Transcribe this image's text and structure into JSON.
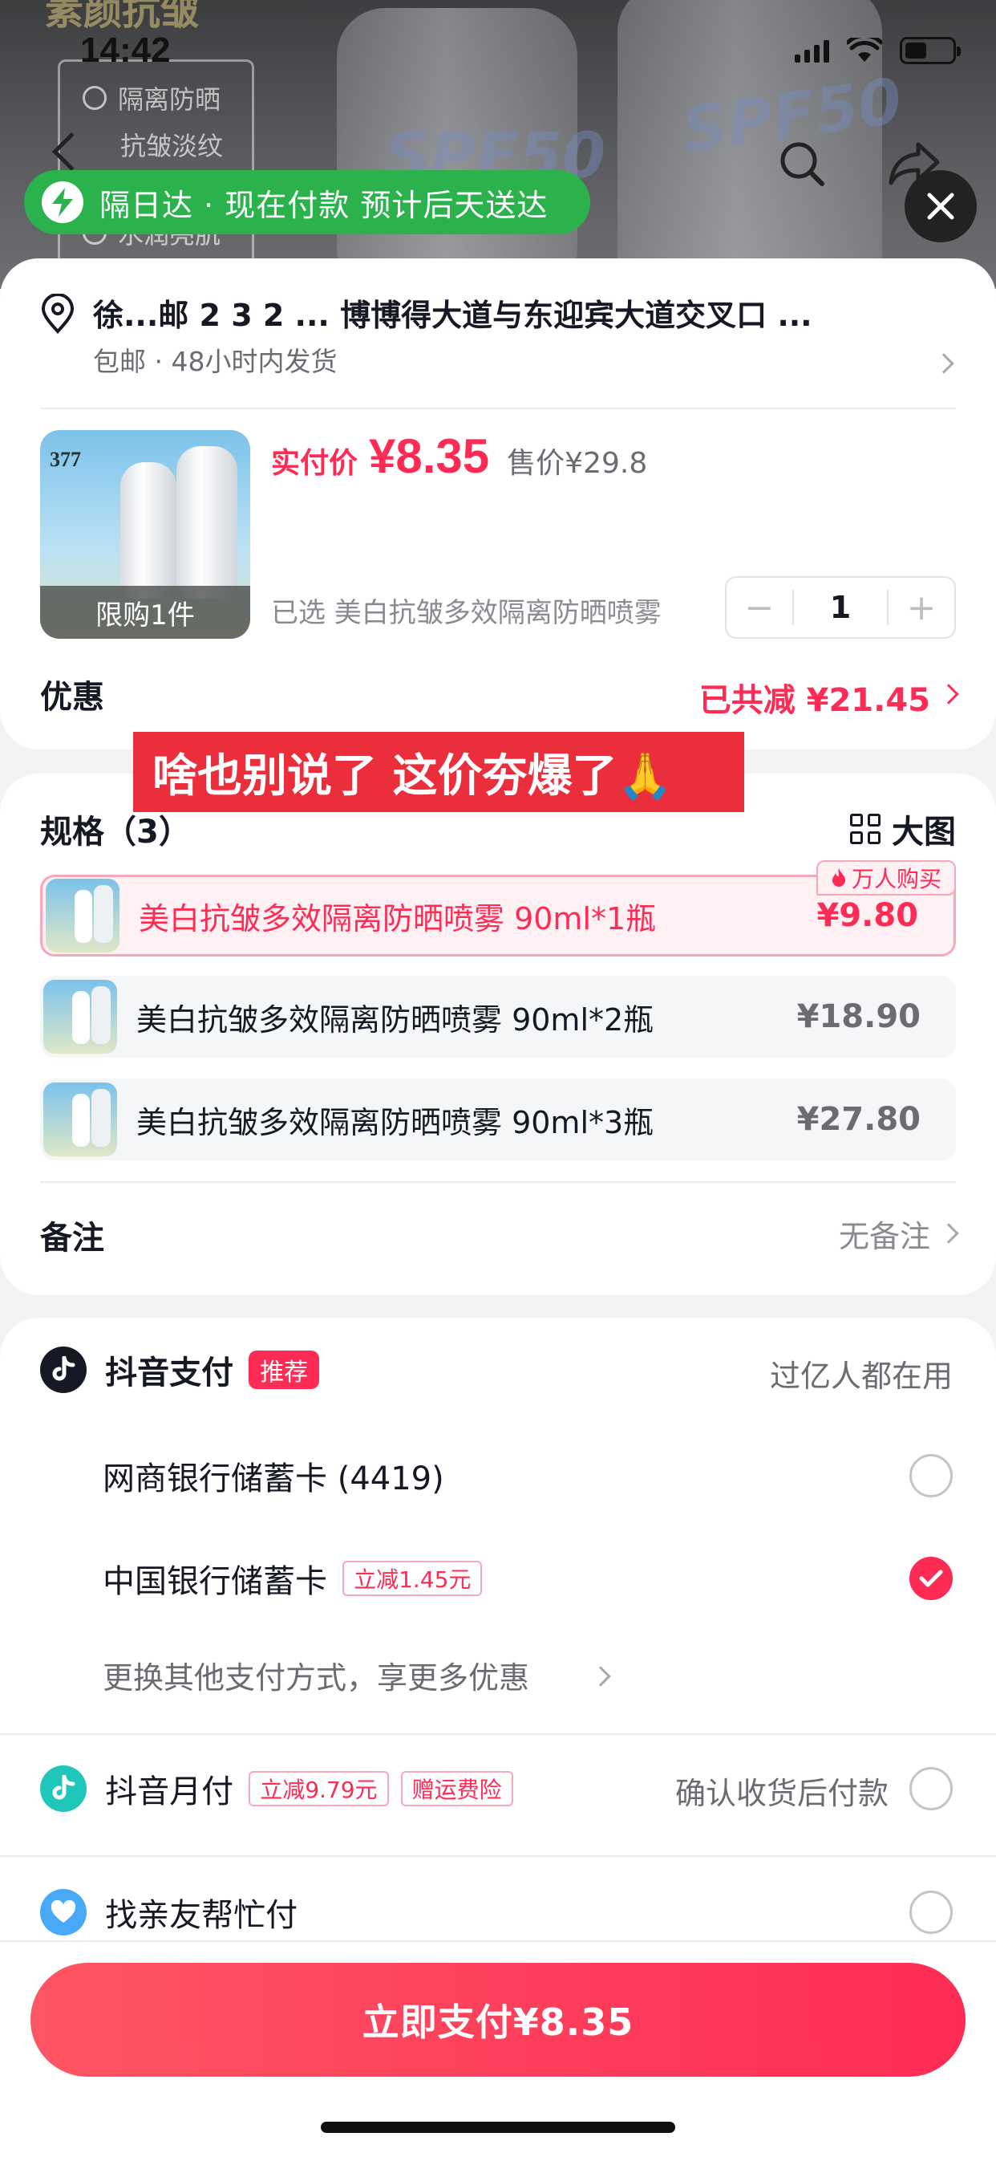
{
  "status_bar": {
    "time": "14:42"
  },
  "background": {
    "promo_text": "素颜抗皱",
    "card_lines": [
      "隔离防晒",
      "抗皱淡纹",
      "水润亮肌"
    ],
    "spf_text": "SPF50"
  },
  "delivery_pill": {
    "text": "隔日达 · 现在付款 预计后天送达"
  },
  "address": {
    "text": "徐...邮 2 3 2 ... 博博得大道与东迎宾大道交叉口 ...",
    "sub": "包邮 · 48小时内发货"
  },
  "product": {
    "image_caption": "限购1件",
    "image_brand": "377",
    "price_label": "实付价",
    "price": "¥8.35",
    "original_price": "售价¥29.8",
    "chosen": "已选  美白抗皱多效隔离防晒喷雾",
    "quantity": "1"
  },
  "discount": {
    "label": "优惠",
    "value": "已共减 ¥21.45"
  },
  "overlay_banner": {
    "text": "啥也别说了 这价夯爆了🙏"
  },
  "specs": {
    "title": "规格（3）",
    "big_view": "大图",
    "hot_badge": "万人购买",
    "items": [
      {
        "name": "美白抗皱多效隔离防晒喷雾 90ml*1瓶",
        "price": "¥9.80",
        "selected": true
      },
      {
        "name": "美白抗皱多效隔离防晒喷雾 90ml*2瓶",
        "price": "¥18.90",
        "selected": false
      },
      {
        "name": "美白抗皱多效隔离防晒喷雾 90ml*3瓶",
        "price": "¥27.80",
        "selected": false
      }
    ]
  },
  "note": {
    "label": "备注",
    "value": "无备注"
  },
  "payment": {
    "douyin_pay": {
      "label": "抖音支付",
      "tag": "推荐",
      "desc": "过亿人都在用"
    },
    "card_1": {
      "label": "网商银行储蓄卡 (4419)",
      "selected": false
    },
    "card_2": {
      "label": "中国银行储蓄卡",
      "tag": "立减1.45元",
      "selected": true
    },
    "more": "更换其他支付方式，享更多优惠",
    "monthly": {
      "label": "抖音月付",
      "tag1": "立减9.79元",
      "tag2": "赠运费险",
      "desc": "确认收货后付款",
      "selected": false
    },
    "friend": {
      "label": "找亲友帮忙付",
      "selected": false
    }
  },
  "pay_button": {
    "label": "立即支付¥8.35"
  },
  "colors": {
    "accent": "#fe2c55",
    "delivery_green": "#2bb24c",
    "banner_red": "#ea2e3b"
  }
}
